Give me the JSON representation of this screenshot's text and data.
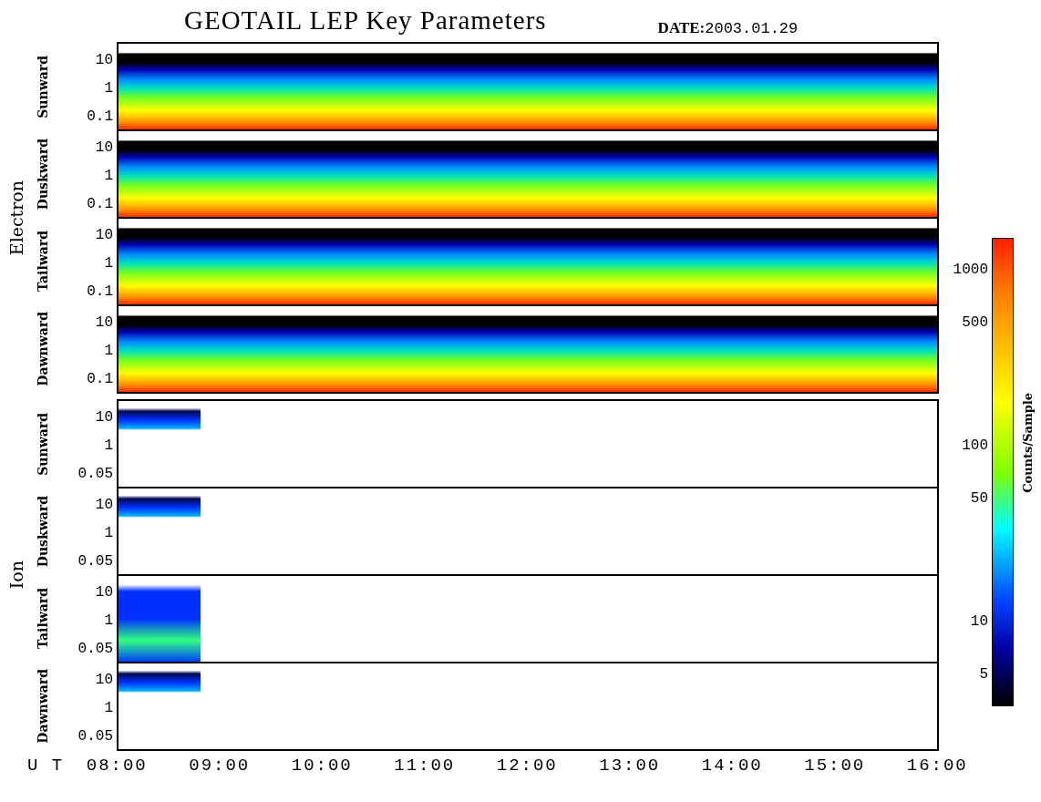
{
  "title": "GEOTAIL LEP Key Parameters",
  "date": {
    "label": "DATE:",
    "value": "2003.01.29"
  },
  "groups": [
    {
      "name": "Electron",
      "kind": "electron",
      "panels": [
        {
          "name": "Sunward",
          "yticks": [
            "10",
            "1",
            "0.1"
          ]
        },
        {
          "name": "Duskward",
          "yticks": [
            "10",
            "1",
            "0.1"
          ]
        },
        {
          "name": "Tailward",
          "yticks": [
            "10",
            "1",
            "0.1"
          ]
        },
        {
          "name": "Dawnward",
          "yticks": [
            "10",
            "1",
            "0.1"
          ]
        }
      ]
    },
    {
      "name": "Ion",
      "kind": "ion",
      "panels": [
        {
          "name": "Sunward",
          "yticks": [
            "10",
            "1",
            "0.05"
          ]
        },
        {
          "name": "Duskward",
          "yticks": [
            "10",
            "1",
            "0.05"
          ]
        },
        {
          "name": "Tailward",
          "yticks": [
            "10",
            "1",
            "0.05"
          ]
        },
        {
          "name": "Dawnward",
          "yticks": [
            "10",
            "1",
            "0.05"
          ]
        }
      ]
    }
  ],
  "x_axis": {
    "label": "U T",
    "ticks": [
      "08:00",
      "09:00",
      "10:00",
      "11:00",
      "12:00",
      "13:00",
      "14:00",
      "15:00",
      "16:00"
    ]
  },
  "colorbar": {
    "title": "Counts/Sample",
    "ticks": [
      "1000",
      "500",
      "100",
      "50",
      "10",
      "5"
    ]
  }
}
